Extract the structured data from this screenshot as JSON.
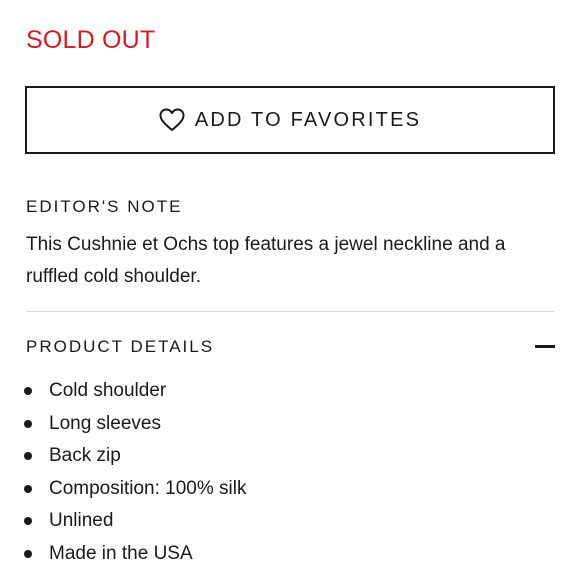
{
  "status": {
    "sold_out": "SOLD OUT",
    "color": "#d61c22"
  },
  "favorites_button": {
    "label": "ADD TO FAVORITES",
    "icon": "heart-outline-icon"
  },
  "editors_note": {
    "heading": "EDITOR'S NOTE",
    "text": "This Cushnie et Ochs top features a jewel neckline and a ruffled cold shoulder."
  },
  "product_details": {
    "heading": "PRODUCT DETAILS",
    "toggle_icon": "minus-icon",
    "items": [
      "Cold shoulder",
      "Long sleeves",
      "Back zip",
      "Composition: 100% silk",
      "Unlined",
      "Made in the USA"
    ]
  }
}
